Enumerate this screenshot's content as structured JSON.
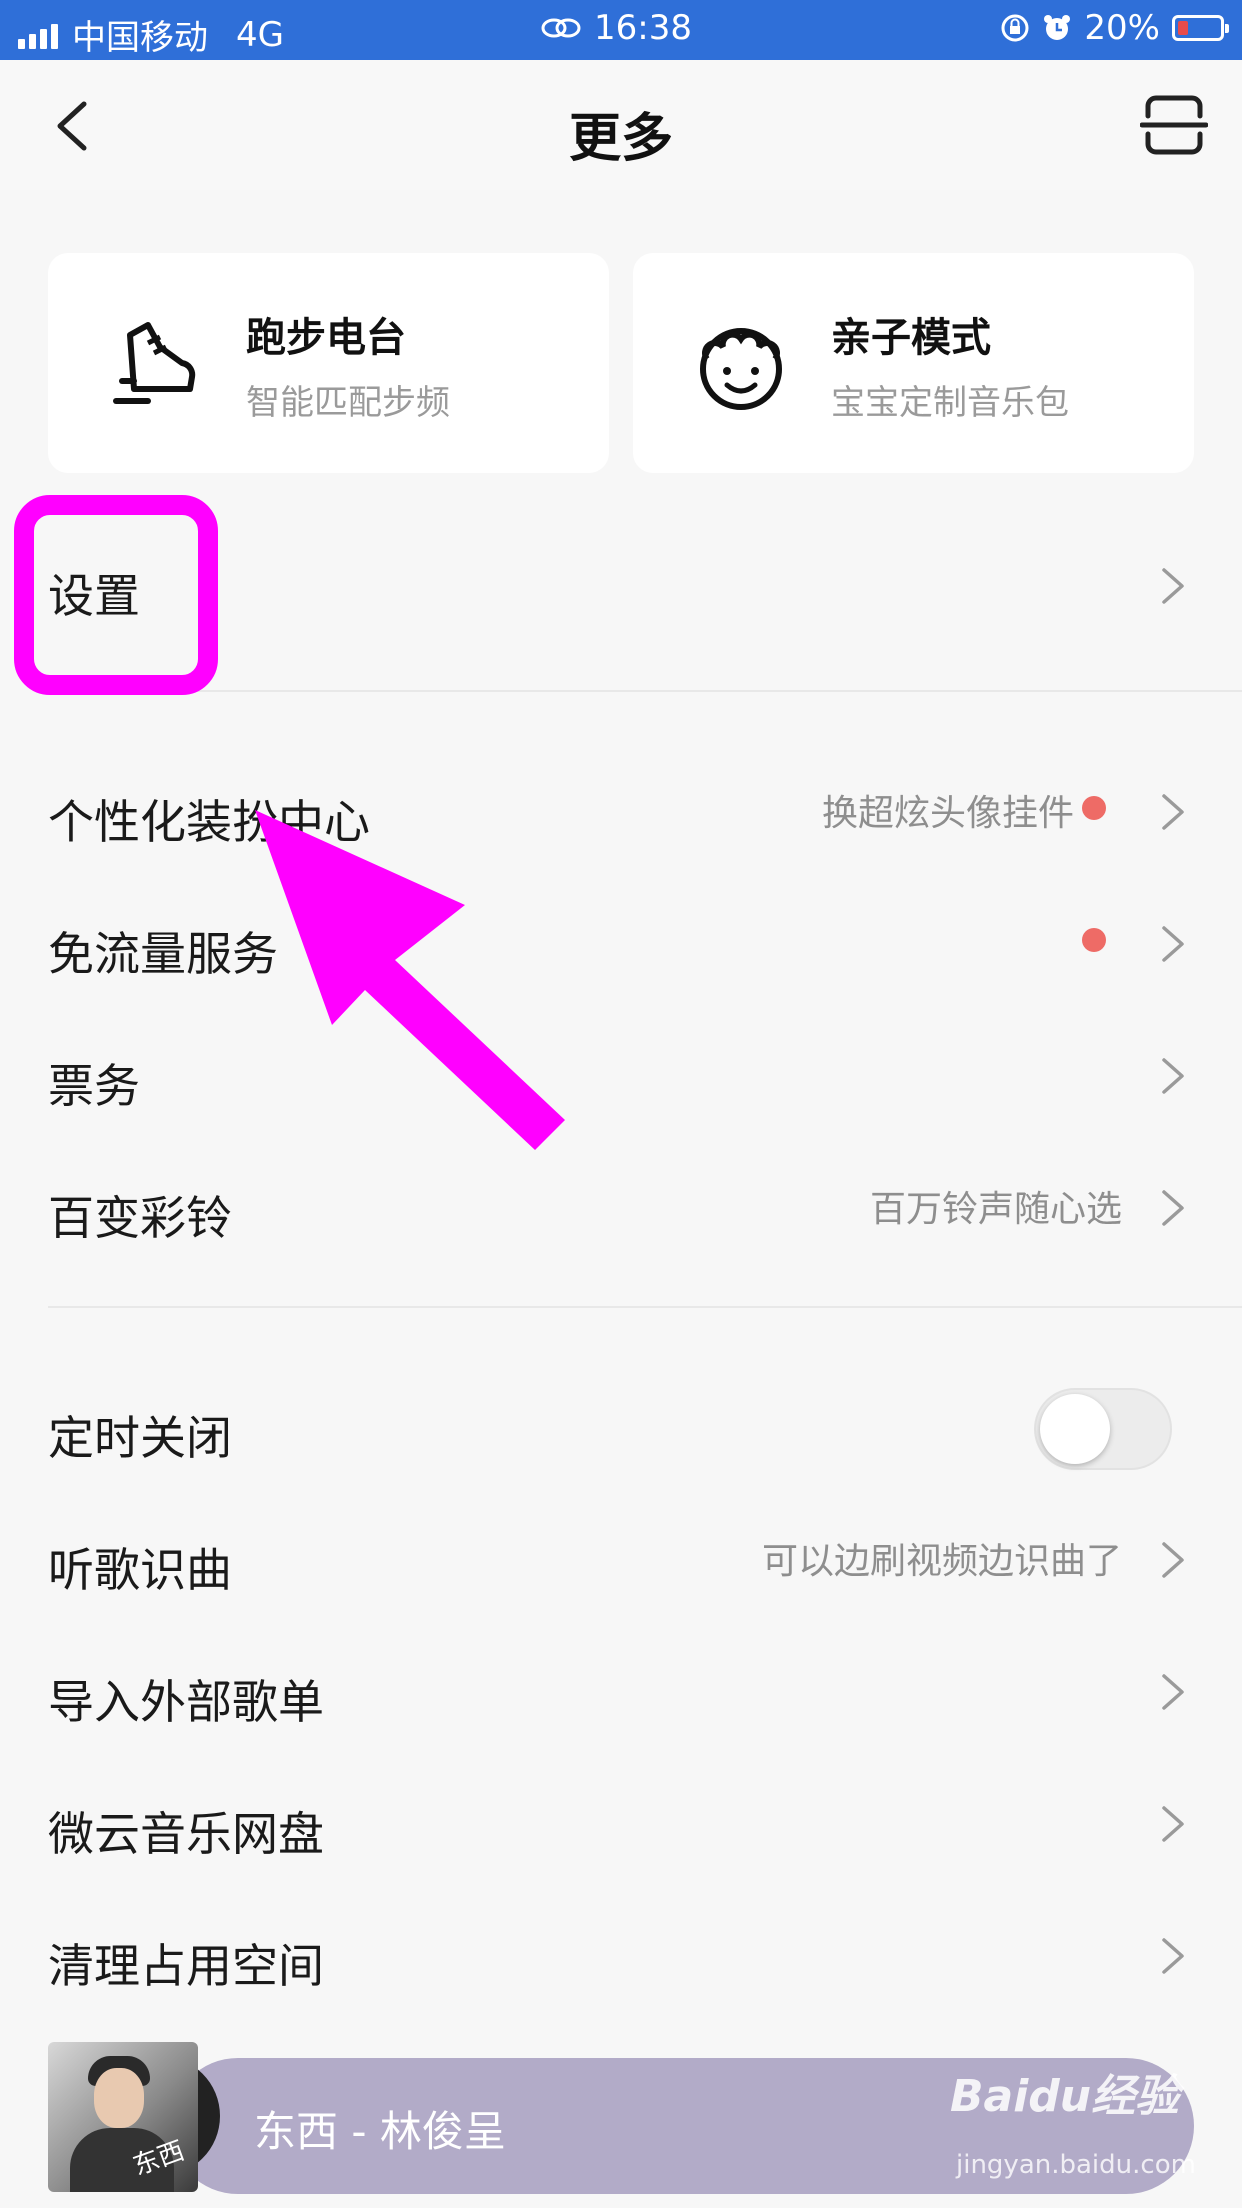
{
  "status_bar": {
    "carrier": "中国移动",
    "network": "4G",
    "time": "16:38",
    "battery": "20%"
  },
  "header": {
    "title": "更多"
  },
  "cards": [
    {
      "title": "跑步电台",
      "subtitle": "智能匹配步频",
      "icon": "running-shoe-icon"
    },
    {
      "title": "亲子模式",
      "subtitle": "宝宝定制音乐包",
      "icon": "child-face-icon"
    }
  ],
  "menu": {
    "settings": "设置",
    "personalize": {
      "label": "个性化装扮中心",
      "hint": "换超炫头像挂件"
    },
    "free_data": {
      "label": "免流量服务"
    },
    "tickets": {
      "label": "票务"
    },
    "ringtone": {
      "label": "百变彩铃",
      "hint": "百万铃声随心选"
    },
    "sleep_timer": {
      "label": "定时关闭",
      "enabled": false
    },
    "song_recognition": {
      "label": "听歌识曲",
      "hint": "可以边刷视频边识曲了"
    },
    "import_playlist": {
      "label": "导入外部歌单"
    },
    "weiyun": {
      "label": "微云音乐网盘"
    },
    "clean_space": {
      "label": "清理占用空间"
    }
  },
  "player": {
    "song": "东西 - 林俊呈",
    "cover_text": "东西"
  },
  "watermark": {
    "brand": "Baidu经验",
    "url": "jingyan.baidu.com"
  },
  "colors": {
    "status_bar": "#2f6fd8",
    "annotation": "#ff00ff",
    "badge_dot": "#ee6b66",
    "player_bg": "#b2abc8"
  }
}
